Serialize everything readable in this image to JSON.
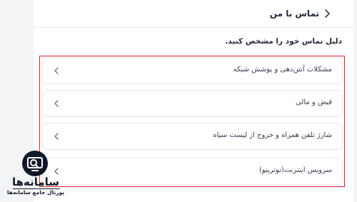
{
  "header": {
    "title": "تماس با من",
    "back_icon": "chevron-right-icon"
  },
  "prompt": "دلیل تماس خود را مشخص کنید.",
  "options": [
    {
      "label": "مشکلات آنتن‌دهی و پوشش شبکه"
    },
    {
      "label": "قبض و مالی"
    },
    {
      "label": "شارژ تلفن همراه و خروج از لیست سیاه"
    },
    {
      "label": "سرویس اینترنت(نوترینو)"
    }
  ],
  "watermark": {
    "name": "سامانه‌ها",
    "tagline": "پورتال جامع سامانه‌ها"
  },
  "colors": {
    "highlight": "#e11d2a",
    "background": "#f3f4f6",
    "card": "#ffffff"
  }
}
